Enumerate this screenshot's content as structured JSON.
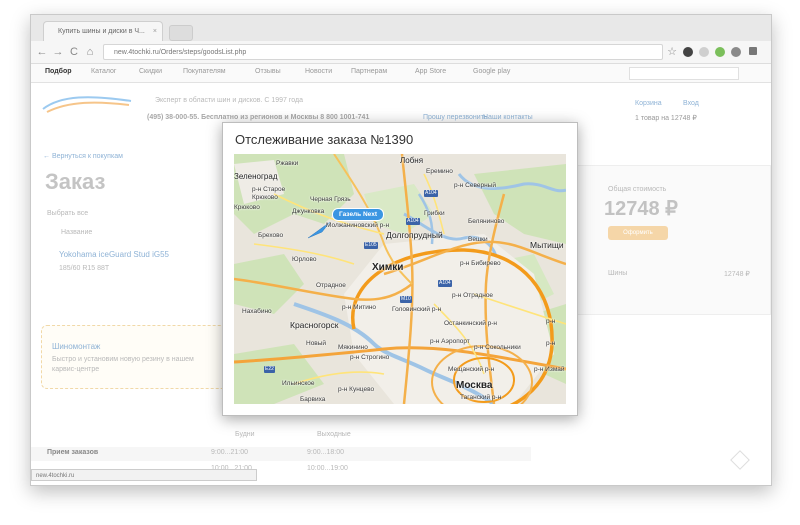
{
  "browser": {
    "tab_title": "Купить шины и диски в Ч...",
    "tab_close": "×",
    "url": "new.4tochki.ru/Orders/steps/goodsList.php",
    "back": "←",
    "forward": "→",
    "reload": "C",
    "home": "⌂",
    "star": "☆",
    "status_url": "new.4tochki.ru"
  },
  "site_nav": {
    "items": [
      "Подбор",
      "Каталог",
      "Скидки",
      "Покупателям",
      "Отзывы",
      "Новости",
      "Партнерам",
      "App Store",
      "Google play"
    ]
  },
  "header": {
    "tagline": "Эксперт в области шин и дисков. С 1997 года",
    "phone_line": "(495) 38-000-55. Бесплатно из регионов и Москвы 8 800 1001-741",
    "callback_link": "Прошу перезвонить",
    "contacts_link": "Наши контакты",
    "cart_link": "Корзина",
    "login_link": "Вход",
    "cart_summary": "1 товар на 12748 ₽"
  },
  "page": {
    "back_link": "← Вернуться к покупкам",
    "title": "Заказ",
    "select_all": "Выбрать все",
    "col_name": "Название",
    "product_name": "Yokohama iceGuard Stud iG55",
    "product_size": "185/60 R15 88T"
  },
  "summary": {
    "label": "Общая стоимость",
    "total": "12748 ₽",
    "order_button": "Оформить",
    "row_label": "Шины",
    "row_value": "12748 ₽"
  },
  "mounting": {
    "title": "Шиномонтаж",
    "text_line1": "Быстро и установим новую резину в нашем",
    "text_line2": "карвис-центре"
  },
  "hours": {
    "weekdays_label": "Будни",
    "weekend_label": "Выходные",
    "row_label": "Прием заказов",
    "weekdays_time": "9:00...21:00",
    "weekend_time": "9:00...18:00",
    "row2_weekdays": "10:00...21:00",
    "row2_weekend": "10:00...19:00"
  },
  "modal": {
    "title": "Отслеживание заказа №1390",
    "vehicle_label": "Газель Next",
    "map_labels": {
      "zelenograd": "Зеленоград",
      "rzhavki": "Ржавки",
      "lobnya": "Лобня",
      "staroe_kryukovo": "р-н Старое\nКрюково",
      "kryukovo": "Крюково",
      "chernaya_gryaz": "Черная Грязь",
      "dzhunovka": "Джунковка",
      "molzhaninovsky": "Молжаниновский р-н",
      "eremino": "Еремино",
      "severny": "р-н Северный",
      "gribki": "Грибки",
      "beliyaninovo": "Беляниново",
      "brekhovo": "Брехово",
      "dolgoprudny": "Долгопрудный",
      "veshki": "Вешки",
      "mytishchi": "Мытищи",
      "yurlovo": "Юрлово",
      "khimki": "Химки",
      "bibirevo": "р-н Бибирево",
      "otradnoe_village": "Отрадное",
      "nakhabino": "Нахабино",
      "mitino": "р-н Митино",
      "golovinsky": "Головинский р-н",
      "otradnoe": "р-н Отрадное",
      "krasnogorsk": "Красногорск",
      "ostankinsky": "Останкинский р-н",
      "novy": "Новый",
      "myakinino": "Мякинино",
      "aeroport": "р-н Аэропорт",
      "sokolniki": "р-н Сокольники",
      "strogino": "р-н Строгино",
      "ilyinskoe": "Ильинское",
      "meshchansky": "Мещанский р-н",
      "izmaylovo": "р-н Измай",
      "kuntsevo": "р-н Кунцево",
      "moskva": "Москва",
      "tagansky": "Таганский р-н",
      "barvikha": "Барвиха",
      "losiny": "р-н",
      "kotelniki": "р-н"
    },
    "road_shields": [
      "A104",
      "A104",
      "E105",
      "M10",
      "E22",
      "A104"
    ]
  }
}
